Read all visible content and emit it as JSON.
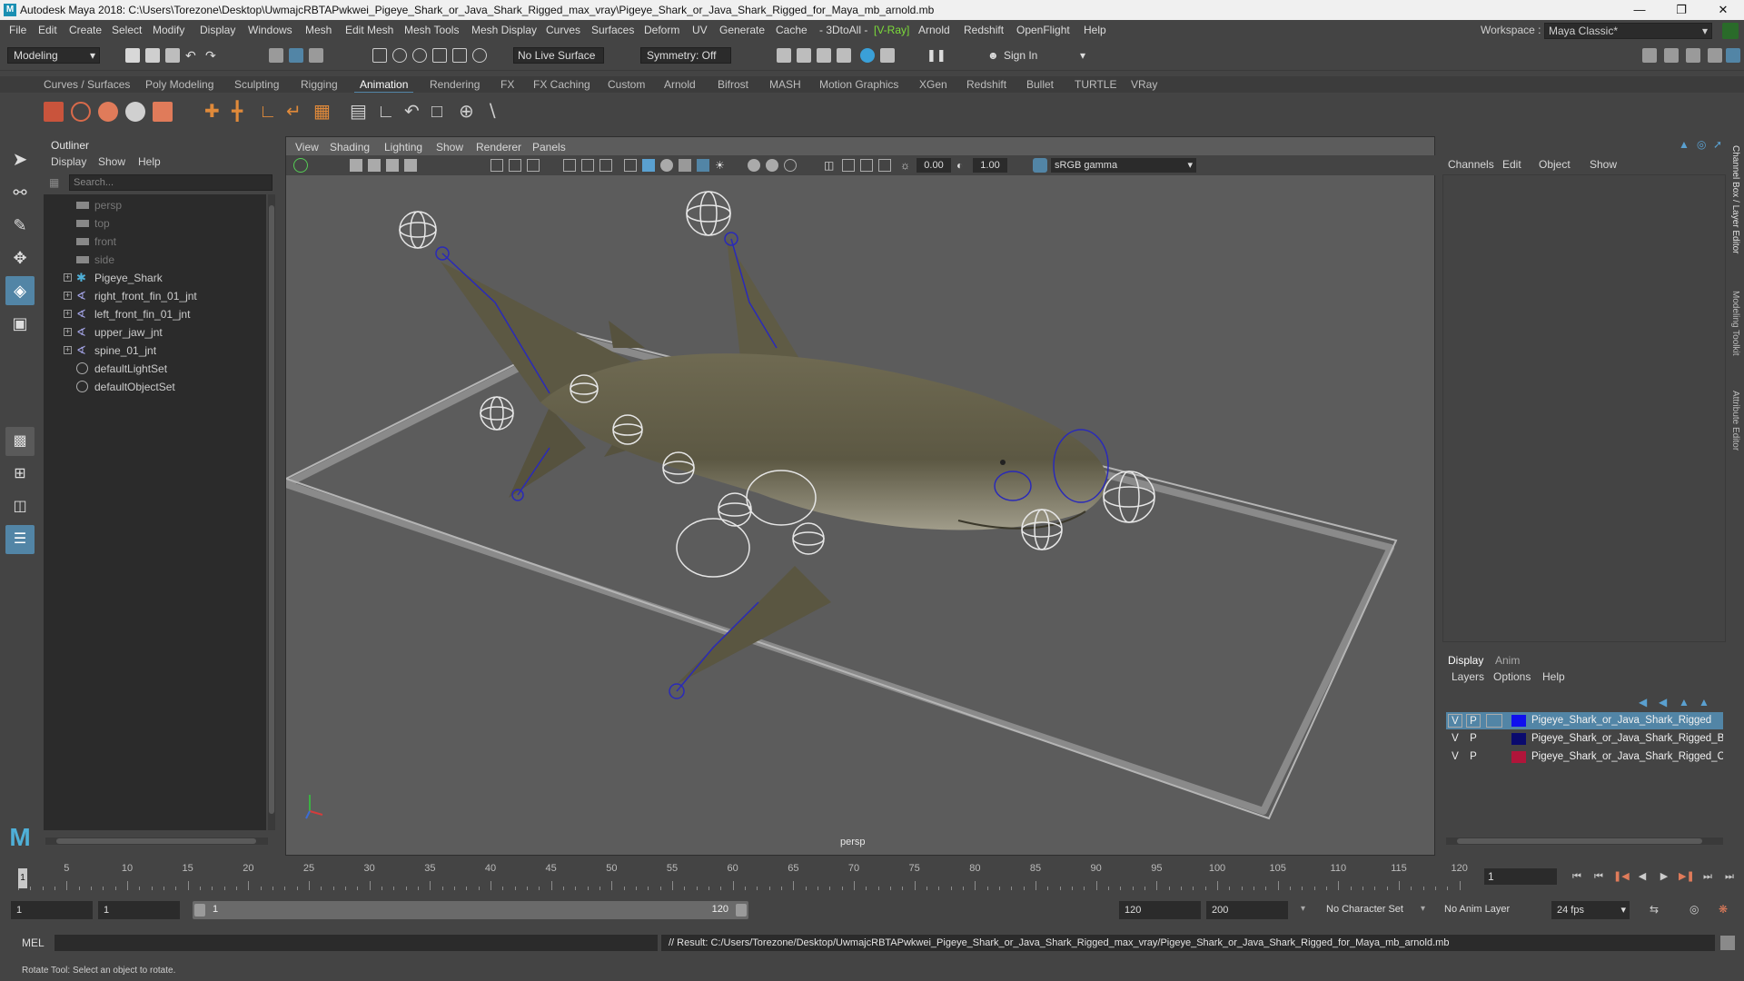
{
  "app": {
    "window_title": "Autodesk Maya 2018: C:\\Users\\Torezone\\Desktop\\UwmajcRBTAPwkwei_Pigeye_Shark_or_Java_Shark_Rigged_max_vray\\Pigeye_Shark_or_Java_Shark_Rigged_for_Maya_mb_arnold.mb",
    "logo": "M"
  },
  "menubar": {
    "items": [
      "File",
      "Edit",
      "Create",
      "Select",
      "Modify",
      "Display",
      "Windows",
      "Mesh",
      "Edit Mesh",
      "Mesh Tools",
      "Mesh Display",
      "Curves",
      "Surfaces",
      "Deform",
      "UV",
      "Generate",
      "Cache",
      "- 3DtoAll -",
      "[V-Ray]",
      "Arnold",
      "Redshift",
      "OpenFlight",
      "Help"
    ],
    "workspace_label": "Workspace :",
    "workspace_value": "Maya Classic*"
  },
  "statusline": {
    "mode": "Modeling",
    "live_surface": "No Live Surface",
    "symmetry": "Symmetry: Off",
    "sign_in": "Sign In"
  },
  "shelf": {
    "tabs": [
      "Curves / Surfaces",
      "Poly Modeling",
      "Sculpting",
      "Rigging",
      "Animation",
      "Rendering",
      "FX",
      "FX Caching",
      "Custom",
      "Arnold",
      "Bifrost",
      "MASH",
      "Motion Graphics",
      "XGen",
      "Redshift",
      "Bullet",
      "TURTLE",
      "VRay"
    ],
    "active_tab": "Animation"
  },
  "outliner": {
    "title": "Outliner",
    "menu": [
      "Display",
      "Show",
      "Help"
    ],
    "search_placeholder": "Search...",
    "items": [
      {
        "label": "persp",
        "icon": "camera-icon",
        "dim": true,
        "expandable": false
      },
      {
        "label": "top",
        "icon": "camera-icon",
        "dim": true,
        "expandable": false
      },
      {
        "label": "front",
        "icon": "camera-icon",
        "dim": true,
        "expandable": false
      },
      {
        "label": "side",
        "icon": "camera-icon",
        "dim": true,
        "expandable": false
      },
      {
        "label": "Pigeye_Shark",
        "icon": "asterisk-icon",
        "dim": false,
        "expandable": true
      },
      {
        "label": "right_front_fin_01_jnt",
        "icon": "joint-icon",
        "dim": false,
        "expandable": true
      },
      {
        "label": "left_front_fin_01_jnt",
        "icon": "joint-icon",
        "dim": false,
        "expandable": true
      },
      {
        "label": "upper_jaw_jnt",
        "icon": "joint-icon",
        "dim": false,
        "expandable": true
      },
      {
        "label": "spine_01_jnt",
        "icon": "joint-icon",
        "dim": false,
        "expandable": true
      },
      {
        "label": "defaultLightSet",
        "icon": "set-icon",
        "dim": false,
        "expandable": false
      },
      {
        "label": "defaultObjectSet",
        "icon": "set-icon",
        "dim": false,
        "expandable": false
      }
    ]
  },
  "viewport": {
    "menu": [
      "View",
      "Shading",
      "Lighting",
      "Show",
      "Renderer",
      "Panels"
    ],
    "exposure": "0.00",
    "gamma": "1.00",
    "color_space": "sRGB gamma",
    "camera_label": "persp"
  },
  "channelbox": {
    "menu": [
      "Channels",
      "Edit",
      "Object",
      "Show"
    ]
  },
  "layers": {
    "tabs": [
      "Display",
      "Anim"
    ],
    "active_tab": "Display",
    "menu": [
      "Layers",
      "Options",
      "Help"
    ],
    "rows": [
      {
        "v": "V",
        "p": "P",
        "color": "#1010ee",
        "name": "Pigeye_Shark_or_Java_Shark_Rigged",
        "selected": true
      },
      {
        "v": "V",
        "p": "P",
        "color": "#0a0a6e",
        "name": "Pigeye_Shark_or_Java_Shark_Rigged_Bones",
        "selected": false
      },
      {
        "v": "V",
        "p": "P",
        "color": "#b0153a",
        "name": "Pigeye_Shark_or_Java_Shark_Rigged_Controllers",
        "selected": false
      }
    ]
  },
  "sidetabs": [
    "Channel Box / Layer Editor",
    "Modeling Toolkit",
    "Attribute Editor"
  ],
  "timeline": {
    "tick_labels": [
      "5",
      "10",
      "15",
      "20",
      "25",
      "30",
      "35",
      "40",
      "45",
      "50",
      "55",
      "60",
      "65",
      "70",
      "75",
      "80",
      "85",
      "90",
      "95",
      "100",
      "105",
      "110",
      "115",
      "120"
    ],
    "current_frame": "1",
    "frame_field": "1"
  },
  "range": {
    "start": "1",
    "playback_start": "1",
    "slider_start": "1",
    "slider_end": "120",
    "playback_end": "120",
    "end": "200",
    "character_set": "No Character Set",
    "anim_layer": "No Anim Layer",
    "fps": "24 fps"
  },
  "commandline": {
    "label": "MEL",
    "result": "// Result: C:/Users/Torezone/Desktop/UwmajcRBTAPwkwei_Pigeye_Shark_or_Java_Shark_Rigged_max_vray/Pigeye_Shark_or_Java_Shark_Rigged_for_Maya_mb_arnold.mb"
  },
  "helpline": {
    "text": "Rotate Tool: Select an object to rotate."
  }
}
